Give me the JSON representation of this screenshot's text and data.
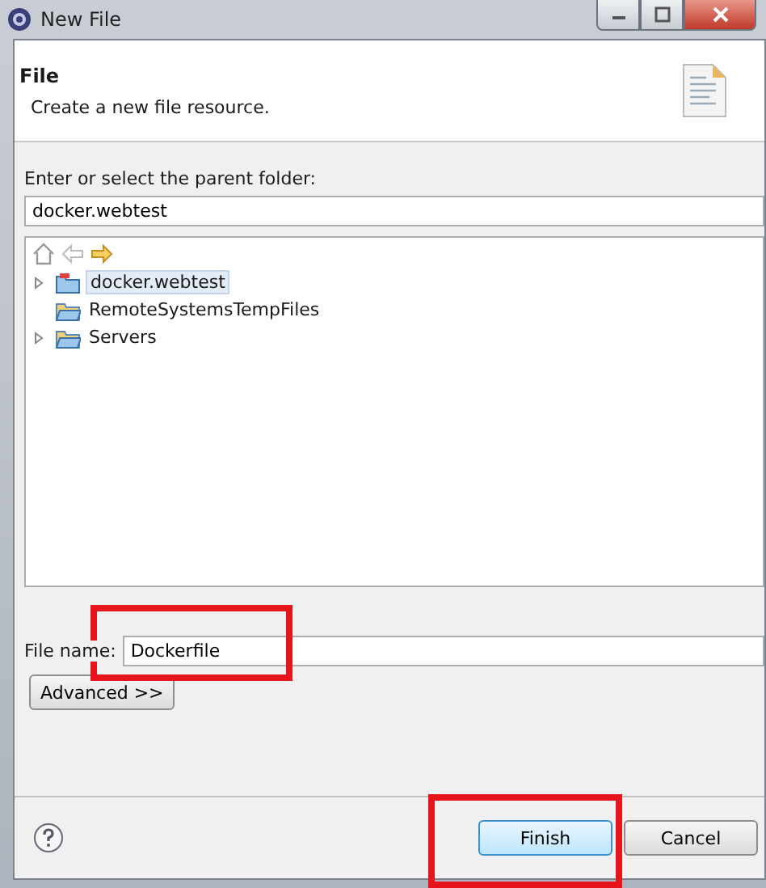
{
  "window": {
    "title": "New File"
  },
  "header": {
    "title": "File",
    "description": "Create a new file resource."
  },
  "parent_folder": {
    "label": "Enter or select the parent folder:",
    "value": "docker.webtest"
  },
  "tree": [
    {
      "label": "docker.webtest",
      "kind": "project",
      "expandable": true,
      "selected": true
    },
    {
      "label": "RemoteSystemsTempFiles",
      "kind": "folder",
      "expandable": false,
      "selected": false
    },
    {
      "label": "Servers",
      "kind": "folder",
      "expandable": true,
      "selected": false
    }
  ],
  "file_name": {
    "label": "File name:",
    "value": "Dockerfile"
  },
  "advanced_button": "Advanced >>",
  "buttons": [
    {
      "label": "Finish",
      "default": true
    },
    {
      "label": "Cancel",
      "default": false
    }
  ]
}
